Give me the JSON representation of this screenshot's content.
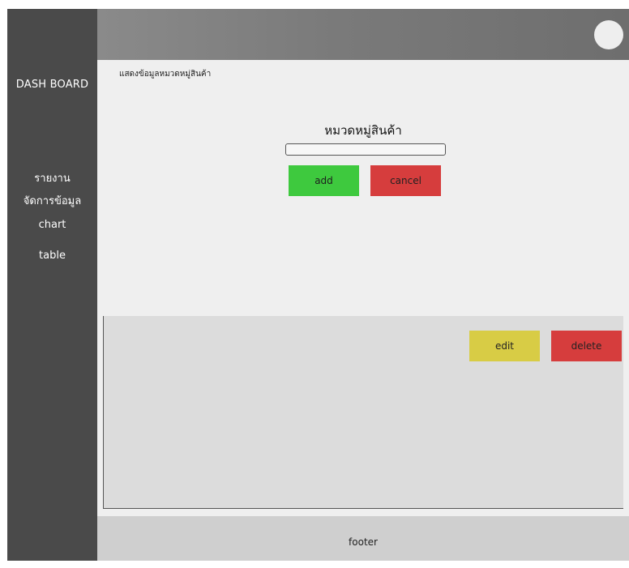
{
  "sidebar": {
    "brand": "DASH BOARD",
    "items": [
      {
        "label": "รายงาน"
      },
      {
        "label": "จัดการข้อมูล"
      },
      {
        "label": "chart"
      },
      {
        "label": "table"
      }
    ]
  },
  "main": {
    "breadcrumb": "แสดงข้อมูลหมวดหมู่สินค้า",
    "form": {
      "title": "หมวดหมู่สินค้า",
      "input_value": "",
      "add_label": "add",
      "cancel_label": "cancel"
    }
  },
  "panel": {
    "edit_label": "edit",
    "delete_label": "delete"
  },
  "footer": {
    "text": "footer"
  },
  "colors": {
    "sidebar": "#4a4a4a",
    "add": "#3ec93e",
    "cancel": "#d63d3d",
    "edit": "#d8cc45",
    "delete": "#d63d3d"
  }
}
